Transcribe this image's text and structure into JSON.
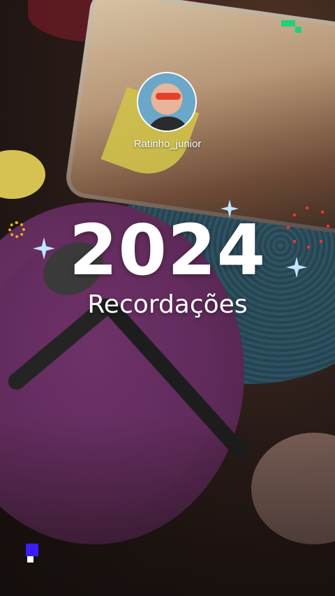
{
  "story": {
    "username": "Ratinho_junior",
    "year": "2024",
    "subtitle": "Recordações"
  },
  "colors": {
    "accent_green": "#21d07a",
    "accent_blue": "#3a1cff",
    "sparkle": "#bfe6ff",
    "gear": "#e0b22a",
    "dots": "#ff3030"
  },
  "icons": [
    "avatar",
    "sparkle-icon",
    "gear-icon",
    "dotted-circle-decoration",
    "pixel-decoration"
  ]
}
